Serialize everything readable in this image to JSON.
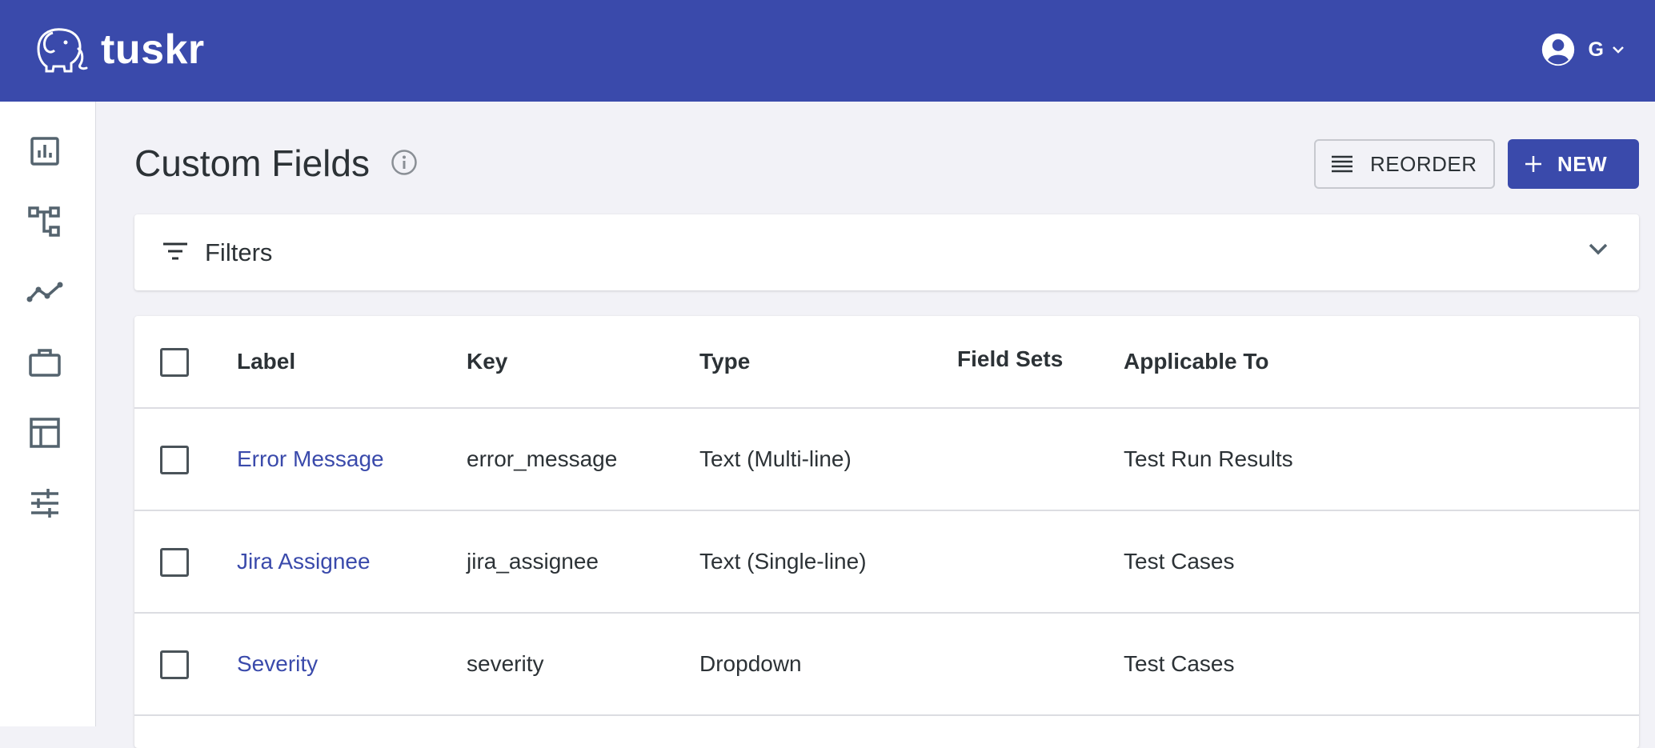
{
  "app": {
    "name": "tuskr",
    "user_initial": "G"
  },
  "page": {
    "title": "Custom Fields"
  },
  "toolbar": {
    "reorder_label": "REORDER",
    "new_label": "NEW"
  },
  "filters": {
    "label": "Filters"
  },
  "table": {
    "columns": [
      "Label",
      "Key",
      "Type",
      "Field Sets",
      "Applicable To"
    ],
    "rows": [
      {
        "label": "Error Message",
        "key": "error_message",
        "type": "Text (Multi-line)",
        "field_sets": "",
        "applicable_to": "Test Run Results"
      },
      {
        "label": "Jira Assignee",
        "key": "jira_assignee",
        "type": "Text (Single-line)",
        "field_sets": "",
        "applicable_to": "Test Cases"
      },
      {
        "label": "Severity",
        "key": "severity",
        "type": "Dropdown",
        "field_sets": "",
        "applicable_to": "Test Cases"
      }
    ]
  },
  "sidebar": {
    "items": [
      {
        "icon": "dashboard-chart-icon"
      },
      {
        "icon": "hierarchy-icon"
      },
      {
        "icon": "activity-line-icon"
      },
      {
        "icon": "briefcase-icon"
      },
      {
        "icon": "table-icon"
      },
      {
        "icon": "settings-sliders-icon"
      }
    ]
  },
  "colors": {
    "brand": "#3a4aab",
    "background": "#f2f2f7",
    "link": "#3a4aab"
  }
}
